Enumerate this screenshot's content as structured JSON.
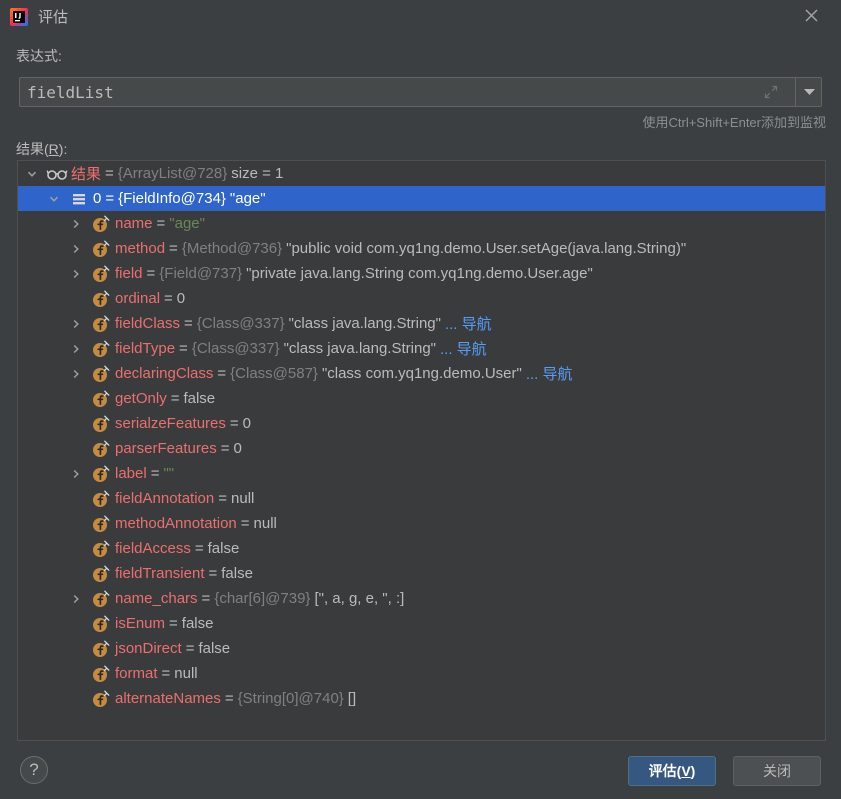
{
  "window": {
    "title": "评估",
    "app_icon": "intellij-idea-icon",
    "close_icon": "close-icon"
  },
  "expression": {
    "label": "表达式:",
    "value": "fieldList",
    "expand_icon": "expand-icon",
    "dropdown_icon": "dropdown-arrow-icon",
    "hint": "使用Ctrl+Shift+Enter添加到监视"
  },
  "result": {
    "label": {
      "before": "结果(",
      "mnemonic": "R",
      "after": "):"
    },
    "equals": "=",
    "rows": [
      {
        "depth": 0,
        "expander": "expanded",
        "icon": "watch-glasses-icon",
        "name": "结果",
        "type": "{ArrayList@728}",
        "value": "size = 1"
      },
      {
        "depth": 1,
        "expander": "expanded",
        "icon": "list-element-icon",
        "name": "0",
        "type": "{FieldInfo@734}",
        "value": "\"age\"",
        "selected": true
      },
      {
        "depth": 2,
        "expander": "collapsed",
        "icon": "field-icon",
        "name": "name",
        "value": "\"age\"",
        "kind": "string"
      },
      {
        "depth": 2,
        "expander": "collapsed",
        "icon": "field-icon",
        "name": "method",
        "type": "{Method@736}",
        "value": "\"public void com.yq1ng.demo.User.setAge(java.lang.String)\""
      },
      {
        "depth": 2,
        "expander": "collapsed",
        "icon": "field-icon",
        "name": "field",
        "type": "{Field@737}",
        "value": "\"private java.lang.String com.yq1ng.demo.User.age\""
      },
      {
        "depth": 2,
        "expander": "none",
        "icon": "field-icon",
        "name": "ordinal",
        "value": "0"
      },
      {
        "depth": 2,
        "expander": "collapsed",
        "icon": "field-icon",
        "name": "fieldClass",
        "type": "{Class@337}",
        "value": "\"class java.lang.String\"",
        "link": "... 导航"
      },
      {
        "depth": 2,
        "expander": "collapsed",
        "icon": "field-icon",
        "name": "fieldType",
        "type": "{Class@337}",
        "value": "\"class java.lang.String\"",
        "link": "... 导航"
      },
      {
        "depth": 2,
        "expander": "collapsed",
        "icon": "field-icon",
        "name": "declaringClass",
        "type": "{Class@587}",
        "value": "\"class com.yq1ng.demo.User\"",
        "link": "... 导航"
      },
      {
        "depth": 2,
        "expander": "none",
        "icon": "field-icon",
        "name": "getOnly",
        "value": "false"
      },
      {
        "depth": 2,
        "expander": "none",
        "icon": "field-icon",
        "name": "serialzeFeatures",
        "value": "0"
      },
      {
        "depth": 2,
        "expander": "none",
        "icon": "field-icon",
        "name": "parserFeatures",
        "value": "0"
      },
      {
        "depth": 2,
        "expander": "collapsed",
        "icon": "field-icon",
        "name": "label",
        "value": "\"\"",
        "kind": "string"
      },
      {
        "depth": 2,
        "expander": "none",
        "icon": "field-icon",
        "name": "fieldAnnotation",
        "value": "null"
      },
      {
        "depth": 2,
        "expander": "none",
        "icon": "field-icon",
        "name": "methodAnnotation",
        "value": "null"
      },
      {
        "depth": 2,
        "expander": "none",
        "icon": "field-icon",
        "name": "fieldAccess",
        "value": "false"
      },
      {
        "depth": 2,
        "expander": "none",
        "icon": "field-icon",
        "name": "fieldTransient",
        "value": "false"
      },
      {
        "depth": 2,
        "expander": "collapsed",
        "icon": "field-icon",
        "name": "name_chars",
        "type": "{char[6]@739}",
        "value": "[\", a, g, e, \", :]"
      },
      {
        "depth": 2,
        "expander": "none",
        "icon": "field-icon",
        "name": "isEnum",
        "value": "false"
      },
      {
        "depth": 2,
        "expander": "none",
        "icon": "field-icon",
        "name": "jsonDirect",
        "value": "false"
      },
      {
        "depth": 2,
        "expander": "none",
        "icon": "field-icon",
        "name": "format",
        "value": "null"
      },
      {
        "depth": 2,
        "expander": "none",
        "icon": "field-icon",
        "name": "alternateNames",
        "type": "{String[0]@740}",
        "value": "[]"
      }
    ]
  },
  "footer": {
    "help": "?",
    "evaluate": {
      "before": "评估(",
      "mnemonic": "V",
      "after": ")"
    },
    "close": "关闭"
  },
  "colors": {
    "selection": "#2f65ca",
    "name": "#ec6f6f",
    "string": "#6a8759",
    "type": "#808080",
    "link": "#589df6",
    "text": "#bbbbbb",
    "primary": "#365880"
  }
}
